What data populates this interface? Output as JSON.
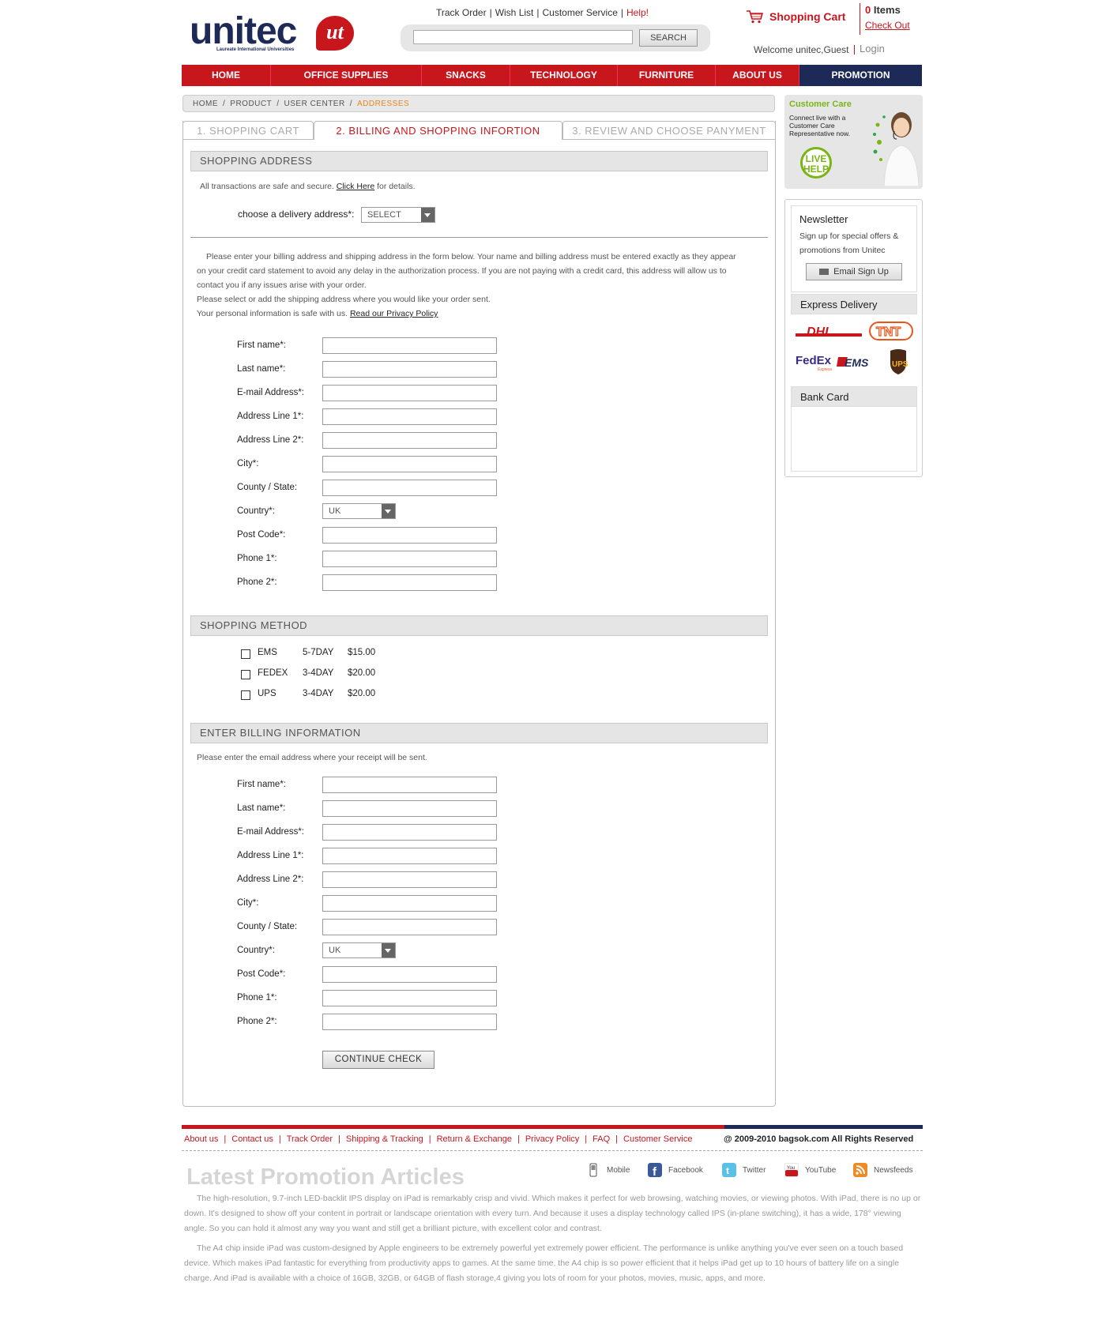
{
  "header": {
    "logo_text": "unitec",
    "logo_badge": "ut",
    "logo_sub": "Laureate International Universities",
    "top_links": [
      "Track Order",
      "Wish List",
      "Customer Service",
      "Help!"
    ],
    "search_placeholder": "",
    "search_button": "SEARCH",
    "cart_title": "Shopping Cart",
    "cart_count": "0",
    "cart_items_label": "Items",
    "checkout": "Check Out",
    "welcome": "Welcome unitec,Guest",
    "login": "Login"
  },
  "nav": {
    "items": [
      "HOME",
      "OFFICE SUPPLIES",
      "SNACKS",
      "TECHNOLOGY",
      "FURNITURE",
      "ABOUT US",
      "PROMOTION"
    ]
  },
  "breadcrumb": {
    "items": [
      "HOME",
      "PRODUCT",
      "USER CENTER"
    ],
    "current": "ADDRESSES"
  },
  "steps": [
    "1.  SHOPPING CART",
    "2.  BILLING AND SHOPPING INFORTION",
    "3.  REVIEW AND CHOOSE PANYMENT"
  ],
  "shipping_address": {
    "heading": "SHOPPING ADDRESS",
    "secure_text": "All transactions are safe and secure.",
    "click_here": "Click Here",
    "secure_tail": "for details.",
    "delivery_label": "choose a delivery address*:",
    "delivery_select": "SELECT",
    "intro_1": "Please enter your billing address and shipping address in the form below. Your name and billing address must be entered exactly as they appear on your credit card statement to avoid any delay in the authorization process. If you are not paying with a credit card, this address will allow us to contact you if any issues arise with your order.",
    "intro_2": "Please select or add the shipping address where you would like your order sent.",
    "intro_3": "Your personal information is safe with us.",
    "privacy_link": "Read our Privacy Policy",
    "fields": [
      "First name*:",
      "Last name*:",
      "E-mail Address*:",
      "Address Line 1*:",
      "Address Line 2*:",
      "City*:",
      "County / State:",
      "Country*:",
      "Post Code*:",
      "Phone 1*:",
      "Phone 2*:"
    ],
    "country_value": "UK"
  },
  "shipping_method": {
    "heading": "SHOPPING METHOD",
    "options": [
      {
        "name": "EMS",
        "days": "5-7DAY",
        "price": "$15.00"
      },
      {
        "name": "FEDEX",
        "days": "3-4DAY",
        "price": "$20.00"
      },
      {
        "name": "UPS",
        "days": "3-4DAY",
        "price": "$20.00"
      }
    ]
  },
  "billing": {
    "heading": "ENTER BILLING INFORMATION",
    "note": "Please enter the email address where your receipt will be sent.",
    "fields": [
      "First name*:",
      "Last name*:",
      "E-mail Address*:",
      "Address Line 1*:",
      "Address Line 2*:",
      "City*:",
      "County / State:",
      "Country*:",
      "Post Code*:",
      "Phone 1*:",
      "Phone 2*:"
    ],
    "country_value": "UK",
    "continue_button": "CONTINUE CHECK"
  },
  "sidebar": {
    "care_title": "Customer Care",
    "care_text": "Connect live with a Customer Care Representative now.",
    "live_help": "LIVE HELP",
    "newsletter_title": "Newsletter",
    "newsletter_text": "Sign up for special offers & promotions from Unitec",
    "newsletter_button": "Email Sign Up",
    "express_title": "Express Delivery",
    "express_logos": [
      "DHL",
      "TNT",
      "FedEx",
      "EMS",
      "UPS"
    ],
    "fedex_sub": "Express",
    "bank_title": "Bank Card"
  },
  "footer": {
    "links": [
      "About us",
      "Contact us",
      "Track Order",
      "Shipping & Tracking",
      "Return & Exchange",
      "Privacy Policy",
      "FAQ",
      "Customer Service"
    ],
    "copyright": "@ 2009-2010 bagsok.com  All Rights Reserved",
    "social": [
      "Mobile",
      "Facebook",
      "Twitter",
      "YouTube",
      "Newsfeeds"
    ],
    "promo_title": "Latest Promotion Articles",
    "promo_p1": "The high-resolution, 9.7-inch LED-backlit IPS display on iPad is remarkably crisp and vivid. Which makes it perfect for web browsing, watching movies, or viewing photos. With iPad, there is no up or down. It's designed to show off your content in portrait or landscape orientation with every turn. And because it uses a display technology called IPS (in-plane switching), it has a wide, 178° viewing angle. So you can hold it almost any way you want and still get a brilliant picture, with excellent color and contrast.",
    "promo_p2": "The A4 chip inside iPad was custom-designed by Apple engineers to be extremely powerful yet extremely power efficient. The performance is unlike anything you've ever seen on a touch based device. Which makes iPad fantastic for everything from productivity apps to games. At the same time, the A4 chip is so power efficient that it helps iPad get up to 10 hours of battery life on a single charge. And iPad is available with a choice of 16GB, 32GB, or 64GB of flash storage,4 giving you lots of room for your photos, movies, music, apps, and more."
  },
  "colors": {
    "brand_red": "#c8161d",
    "brand_navy": "#1d2a57",
    "breadcrumb_current": "#e8861b",
    "care_green": "#7ab515"
  }
}
